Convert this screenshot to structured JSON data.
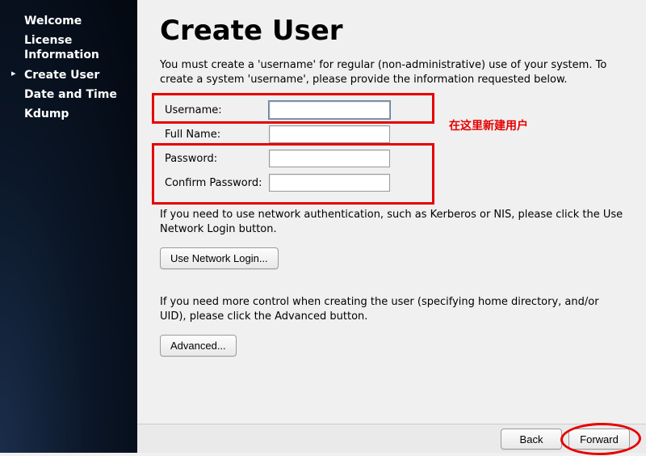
{
  "sidebar": {
    "items": [
      {
        "label": "Welcome"
      },
      {
        "label": "License Information"
      },
      {
        "label": "Create User",
        "active": true
      },
      {
        "label": "Date and Time"
      },
      {
        "label": "Kdump"
      }
    ]
  },
  "page": {
    "title": "Create User",
    "intro": "You must create a 'username' for regular (non-administrative) use of your system.  To create a system 'username', please provide the information requested below.",
    "network_auth_text": "If you need to use network authentication, such as Kerberos or NIS, please click the Use Network Login button.",
    "advanced_text": "If you need more control when creating the user (specifying home directory, and/or UID), please click the Advanced button."
  },
  "form": {
    "username_label": "Username:",
    "username_value": "",
    "fullname_label": "Full Name:",
    "fullname_value": "",
    "password_label": "Password:",
    "password_value": "",
    "confirm_label": "Confirm Password:",
    "confirm_value": ""
  },
  "buttons": {
    "network_login": "Use Network Login...",
    "advanced": "Advanced...",
    "back": "Back",
    "forward": "Forward"
  },
  "annotation": {
    "create_here": "在这里新建用户"
  }
}
